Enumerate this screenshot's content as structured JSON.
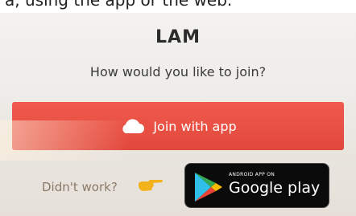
{
  "top_strip_text": "a, using the app or the web.",
  "title": "LAM",
  "subtitle": "How would you like to join?",
  "join_button": {
    "label": "Join with app",
    "color": "#e6493d"
  },
  "fallback": {
    "question": "Didn't work?",
    "badge_small": "ANDROID APP ON",
    "badge_big": "Google play"
  },
  "icons": [
    "cloud-icon",
    "pointing-hand-icon",
    "google-play-logo-icon"
  ]
}
